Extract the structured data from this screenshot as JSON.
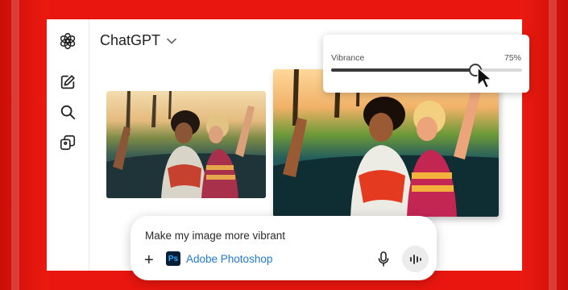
{
  "app": {
    "title": "ChatGPT"
  },
  "sidebar": {
    "items": [
      {
        "icon": "openai-logo-icon"
      },
      {
        "icon": "new-chat-icon"
      },
      {
        "icon": "search-icon"
      },
      {
        "icon": "library-icon"
      }
    ]
  },
  "vibrance": {
    "label": "Vibrance",
    "value_text": "75%",
    "level": 0.75
  },
  "prompt": {
    "text": "Make my image more vibrant",
    "app_chip": {
      "icon_text": "Ps",
      "label": "Adobe Photoshop"
    }
  },
  "colors": {
    "background": "#e8160e",
    "photoshop_blue": "#31a8ff",
    "photoshop_dark": "#001e36",
    "link_blue": "#1f7ad6"
  }
}
